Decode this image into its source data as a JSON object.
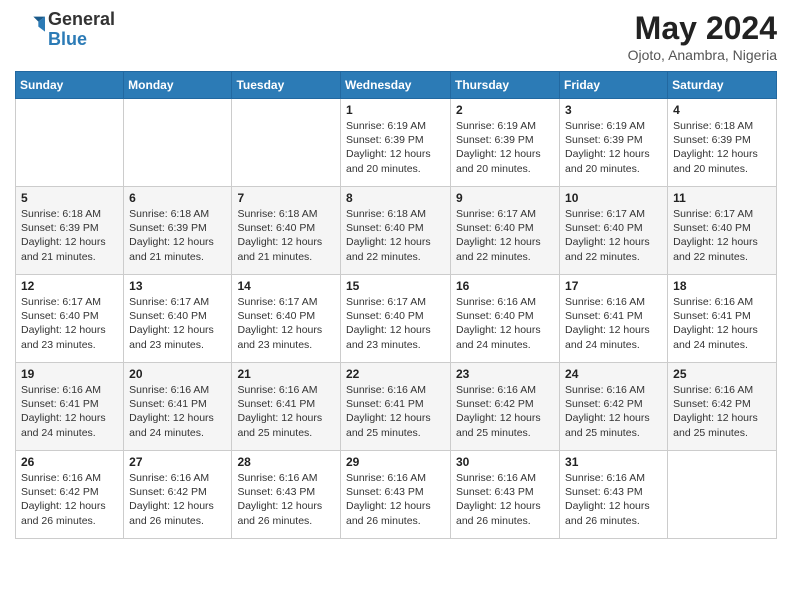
{
  "logo": {
    "general": "General",
    "blue": "Blue"
  },
  "title": "May 2024",
  "subtitle": "Ojoto, Anambra, Nigeria",
  "days_of_week": [
    "Sunday",
    "Monday",
    "Tuesday",
    "Wednesday",
    "Thursday",
    "Friday",
    "Saturday"
  ],
  "weeks": [
    [
      {
        "day": "",
        "info": ""
      },
      {
        "day": "",
        "info": ""
      },
      {
        "day": "",
        "info": ""
      },
      {
        "day": "1",
        "info": "Sunrise: 6:19 AM\nSunset: 6:39 PM\nDaylight: 12 hours and 20 minutes."
      },
      {
        "day": "2",
        "info": "Sunrise: 6:19 AM\nSunset: 6:39 PM\nDaylight: 12 hours and 20 minutes."
      },
      {
        "day": "3",
        "info": "Sunrise: 6:19 AM\nSunset: 6:39 PM\nDaylight: 12 hours and 20 minutes."
      },
      {
        "day": "4",
        "info": "Sunrise: 6:18 AM\nSunset: 6:39 PM\nDaylight: 12 hours and 20 minutes."
      }
    ],
    [
      {
        "day": "5",
        "info": "Sunrise: 6:18 AM\nSunset: 6:39 PM\nDaylight: 12 hours and 21 minutes."
      },
      {
        "day": "6",
        "info": "Sunrise: 6:18 AM\nSunset: 6:39 PM\nDaylight: 12 hours and 21 minutes."
      },
      {
        "day": "7",
        "info": "Sunrise: 6:18 AM\nSunset: 6:40 PM\nDaylight: 12 hours and 21 minutes."
      },
      {
        "day": "8",
        "info": "Sunrise: 6:18 AM\nSunset: 6:40 PM\nDaylight: 12 hours and 22 minutes."
      },
      {
        "day": "9",
        "info": "Sunrise: 6:17 AM\nSunset: 6:40 PM\nDaylight: 12 hours and 22 minutes."
      },
      {
        "day": "10",
        "info": "Sunrise: 6:17 AM\nSunset: 6:40 PM\nDaylight: 12 hours and 22 minutes."
      },
      {
        "day": "11",
        "info": "Sunrise: 6:17 AM\nSunset: 6:40 PM\nDaylight: 12 hours and 22 minutes."
      }
    ],
    [
      {
        "day": "12",
        "info": "Sunrise: 6:17 AM\nSunset: 6:40 PM\nDaylight: 12 hours and 23 minutes."
      },
      {
        "day": "13",
        "info": "Sunrise: 6:17 AM\nSunset: 6:40 PM\nDaylight: 12 hours and 23 minutes."
      },
      {
        "day": "14",
        "info": "Sunrise: 6:17 AM\nSunset: 6:40 PM\nDaylight: 12 hours and 23 minutes."
      },
      {
        "day": "15",
        "info": "Sunrise: 6:17 AM\nSunset: 6:40 PM\nDaylight: 12 hours and 23 minutes."
      },
      {
        "day": "16",
        "info": "Sunrise: 6:16 AM\nSunset: 6:40 PM\nDaylight: 12 hours and 24 minutes."
      },
      {
        "day": "17",
        "info": "Sunrise: 6:16 AM\nSunset: 6:41 PM\nDaylight: 12 hours and 24 minutes."
      },
      {
        "day": "18",
        "info": "Sunrise: 6:16 AM\nSunset: 6:41 PM\nDaylight: 12 hours and 24 minutes."
      }
    ],
    [
      {
        "day": "19",
        "info": "Sunrise: 6:16 AM\nSunset: 6:41 PM\nDaylight: 12 hours and 24 minutes."
      },
      {
        "day": "20",
        "info": "Sunrise: 6:16 AM\nSunset: 6:41 PM\nDaylight: 12 hours and 24 minutes."
      },
      {
        "day": "21",
        "info": "Sunrise: 6:16 AM\nSunset: 6:41 PM\nDaylight: 12 hours and 25 minutes."
      },
      {
        "day": "22",
        "info": "Sunrise: 6:16 AM\nSunset: 6:41 PM\nDaylight: 12 hours and 25 minutes."
      },
      {
        "day": "23",
        "info": "Sunrise: 6:16 AM\nSunset: 6:42 PM\nDaylight: 12 hours and 25 minutes."
      },
      {
        "day": "24",
        "info": "Sunrise: 6:16 AM\nSunset: 6:42 PM\nDaylight: 12 hours and 25 minutes."
      },
      {
        "day": "25",
        "info": "Sunrise: 6:16 AM\nSunset: 6:42 PM\nDaylight: 12 hours and 25 minutes."
      }
    ],
    [
      {
        "day": "26",
        "info": "Sunrise: 6:16 AM\nSunset: 6:42 PM\nDaylight: 12 hours and 26 minutes."
      },
      {
        "day": "27",
        "info": "Sunrise: 6:16 AM\nSunset: 6:42 PM\nDaylight: 12 hours and 26 minutes."
      },
      {
        "day": "28",
        "info": "Sunrise: 6:16 AM\nSunset: 6:43 PM\nDaylight: 12 hours and 26 minutes."
      },
      {
        "day": "29",
        "info": "Sunrise: 6:16 AM\nSunset: 6:43 PM\nDaylight: 12 hours and 26 minutes."
      },
      {
        "day": "30",
        "info": "Sunrise: 6:16 AM\nSunset: 6:43 PM\nDaylight: 12 hours and 26 minutes."
      },
      {
        "day": "31",
        "info": "Sunrise: 6:16 AM\nSunset: 6:43 PM\nDaylight: 12 hours and 26 minutes."
      },
      {
        "day": "",
        "info": ""
      }
    ]
  ]
}
